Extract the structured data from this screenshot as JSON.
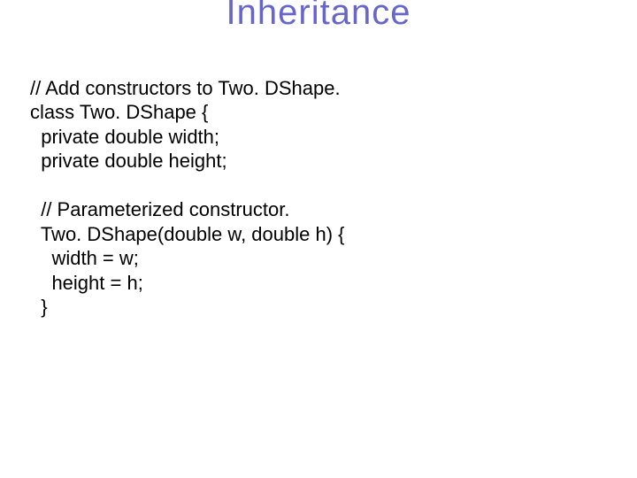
{
  "title": "Inheritance",
  "code": {
    "l1": "// Add constructors to Two. DShape.",
    "l2": "class Two. DShape {",
    "l3": "  private double width;",
    "l4": "  private double height;",
    "l5": "",
    "l6": "  // Parameterized constructor.",
    "l7": "  Two. DShape(double w, double h) {",
    "l8": "    width = w;",
    "l9": "    height = h;",
    "l10": "  }"
  }
}
